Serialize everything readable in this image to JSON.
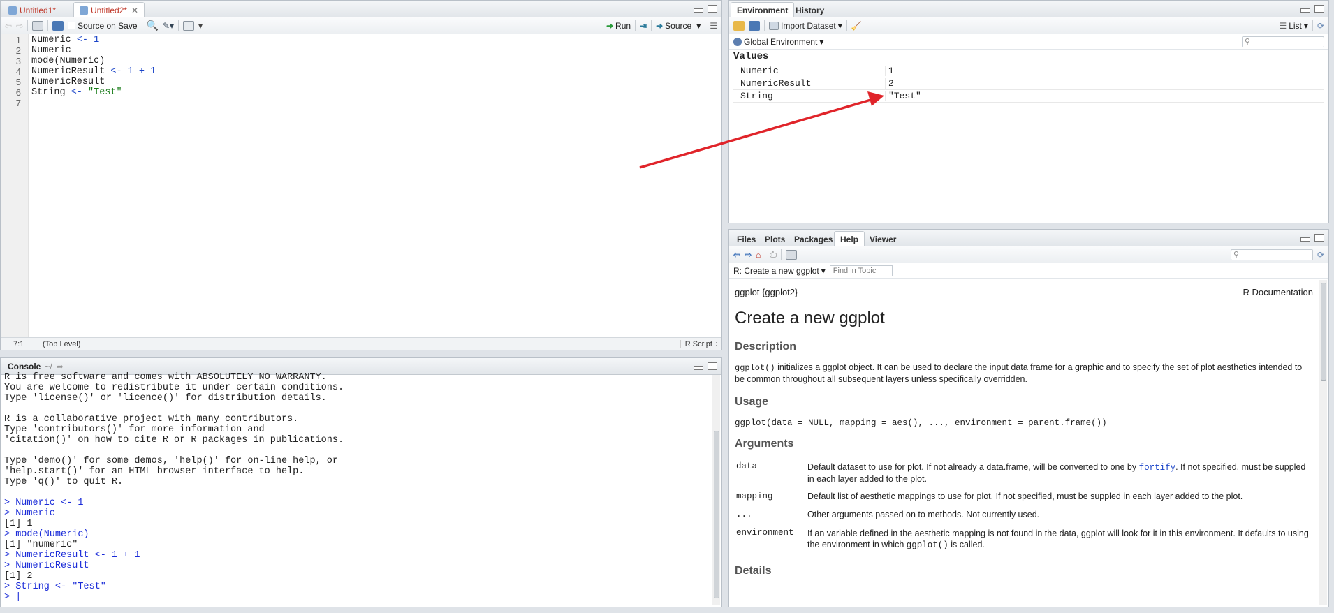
{
  "editor": {
    "tabs": [
      {
        "label": "Untitled1*"
      },
      {
        "label": "Untitled2*"
      }
    ],
    "toolbar": {
      "source_on_save": "Source on Save",
      "run": "Run",
      "source": "Source"
    },
    "line_numbers": [
      "1",
      "2",
      "3",
      "4",
      "5",
      "6",
      "7"
    ],
    "lines": [
      [
        {
          "t": "Numeric ",
          "c": ""
        },
        {
          "t": "<- 1",
          "c": "blue"
        }
      ],
      [
        {
          "t": "Numeric",
          "c": ""
        }
      ],
      [
        {
          "t": "mode(Numeric)",
          "c": ""
        }
      ],
      [
        {
          "t": "NumericResult ",
          "c": ""
        },
        {
          "t": "<- 1 + 1",
          "c": "blue"
        }
      ],
      [
        {
          "t": "NumericResult",
          "c": ""
        }
      ],
      [
        {
          "t": "String ",
          "c": ""
        },
        {
          "t": "<- ",
          "c": "blue"
        },
        {
          "t": "\"Test\"",
          "c": "green"
        }
      ],
      [
        {
          "t": "",
          "c": ""
        }
      ]
    ],
    "status": {
      "position": "7:1",
      "scope": "(Top Level) ÷",
      "filetype": "R Script ÷"
    }
  },
  "console": {
    "title": "Console",
    "path": "~/",
    "lines": [
      {
        "t": "R is free software and comes with ABSOLUTELY NO WARRANTY.",
        "in": false
      },
      {
        "t": "You are welcome to redistribute it under certain conditions.",
        "in": false
      },
      {
        "t": "Type 'license()' or 'licence()' for distribution details.",
        "in": false
      },
      {
        "t": "",
        "in": false
      },
      {
        "t": "R is a collaborative project with many contributors.",
        "in": false
      },
      {
        "t": "Type 'contributors()' for more information and",
        "in": false
      },
      {
        "t": "'citation()' on how to cite R or R packages in publications.",
        "in": false
      },
      {
        "t": "",
        "in": false
      },
      {
        "t": "Type 'demo()' for some demos, 'help()' for on-line help, or",
        "in": false
      },
      {
        "t": "'help.start()' for an HTML browser interface to help.",
        "in": false
      },
      {
        "t": "Type 'q()' to quit R.",
        "in": false
      },
      {
        "t": "",
        "in": false
      },
      {
        "t": "> Numeric <- 1",
        "in": true
      },
      {
        "t": "> Numeric",
        "in": true
      },
      {
        "t": "[1] 1",
        "in": false
      },
      {
        "t": "> mode(Numeric)",
        "in": true
      },
      {
        "t": "[1] \"numeric\"",
        "in": false
      },
      {
        "t": "> NumericResult <- 1 + 1",
        "in": true
      },
      {
        "t": "> NumericResult",
        "in": true
      },
      {
        "t": "[1] 2",
        "in": false
      },
      {
        "t": "> String <- \"Test\"",
        "in": true
      },
      {
        "t": "> |",
        "in": true
      }
    ]
  },
  "environment": {
    "tabs": [
      {
        "label": "Environment"
      },
      {
        "label": "History"
      }
    ],
    "import": "Import Dataset",
    "view": "List",
    "scope": "Global Environment",
    "section": "Values",
    "rows": [
      {
        "name": "Numeric",
        "value": "1"
      },
      {
        "name": "NumericResult",
        "value": "2"
      },
      {
        "name": "String",
        "value": "\"Test\""
      }
    ]
  },
  "files": {
    "tabs": [
      {
        "label": "Files"
      },
      {
        "label": "Plots"
      },
      {
        "label": "Packages"
      },
      {
        "label": "Help"
      },
      {
        "label": "Viewer"
      }
    ],
    "topic": "R: Create a new ggplot",
    "find_placeholder": "Find in Topic"
  },
  "help": {
    "pkg": "ggplot {ggplot2}",
    "docs": "R Documentation",
    "title": "Create a new ggplot",
    "desc_h": "Description",
    "desc_code": "ggplot()",
    "desc_text": " initializes a ggplot object. It can be used to declare the input data frame for a graphic and to specify the set of plot aesthetics intended to be common throughout all subsequent layers unless specifically overridden.",
    "usage_h": "Usage",
    "usage": "ggplot(data = NULL, mapping = aes(), ..., environment = parent.frame())",
    "args_h": "Arguments",
    "args": [
      {
        "name": "data",
        "pre": "Default dataset to use for plot. If not already a data.frame, will be converted to one by ",
        "link": "fortify",
        "post": ". If not specified, must be suppled in each layer added to the plot."
      },
      {
        "name": "mapping",
        "pre": "Default list of aesthetic mappings to use for plot. If not specified, must be suppled in each layer added to the plot.",
        "link": "",
        "post": ""
      },
      {
        "name": "...",
        "pre": "Other arguments passed on to methods. Not currently used.",
        "link": "",
        "post": ""
      },
      {
        "name": "environment",
        "pre": "If an variable defined in the aesthetic mapping is not found in the data, ggplot will look for it in this environment. It defaults to using the environment in which ",
        "link": "",
        "post": "",
        "code": "ggplot()",
        "tail": " is called."
      }
    ],
    "details_h": "Details"
  }
}
